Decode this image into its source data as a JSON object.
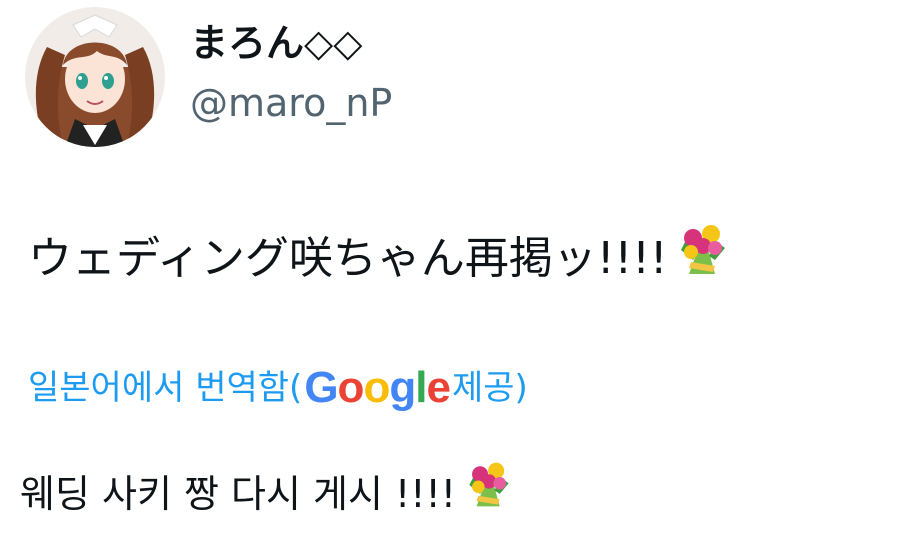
{
  "tweet": {
    "display_name": "まろん◇◇",
    "handle": "@maro_nP",
    "text": "ウェディング咲ちゃん再掲ッ!!!!",
    "emoji": "bouquet",
    "translation": {
      "prefix": "일본어에서 번역함(",
      "provider": "Google",
      "provider_letters": [
        "G",
        "o",
        "o",
        "g",
        "l",
        "e"
      ],
      "suffix": " 제공)",
      "text": "웨딩 사키 짱 다시 게시 !!!!"
    }
  },
  "colors": {
    "link": "#1d9bf0",
    "handle": "#536471",
    "text": "#0f1419",
    "google_blue": "#4285F4",
    "google_red": "#EA4335",
    "google_yellow": "#FBBC05",
    "google_green": "#34A853"
  }
}
